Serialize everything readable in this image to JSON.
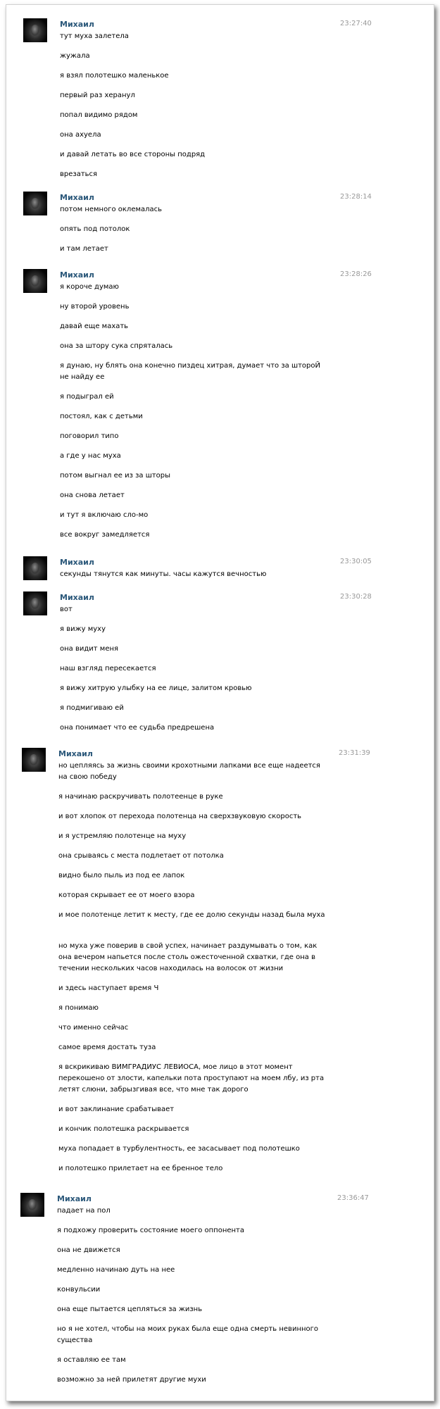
{
  "groups": [
    {
      "author": "Михаил",
      "time": "23:27:40",
      "lines": [
        "тут муха залетела",
        "жужала",
        "я взял полотешко маленькое",
        "первый раз херанул",
        "попал видимо рядом",
        "она ахуела",
        "и давай летать во все стороны подряд",
        "врезаться"
      ]
    },
    {
      "author": "Михаил",
      "time": "23:28:14",
      "lines": [
        "потом немного оклемалась",
        "опять под потолок",
        "и там летает"
      ]
    },
    {
      "author": "Михаил",
      "time": "23:28:26",
      "lines": [
        "я короче думаю",
        "ну второй уровень",
        "давай еще махать",
        "она за штору сука спряталась",
        "я дунаю, ну блять она конечно пиздец хитрая, думает что за штороЙ не найду ее",
        "я подыграл ей",
        "постоял, как с детьми",
        "поговорил типо",
        "а где у нас муха",
        "потом выгнал ее из за шторы",
        "она снова летает",
        "и тут я включаю сло-мо",
        "все вокруг замедляется"
      ]
    },
    {
      "author": "Михаил",
      "time": "23:30:05",
      "lines": [
        "секунды тянутся как минуты. часы кажутся вечностью"
      ]
    },
    {
      "author": "Михаил",
      "time": "23:30:28",
      "lines": [
        "вот",
        "я вижу муху",
        "она видит меня",
        "наш взгляд пересекается",
        "я вижу хитрую улыбку на ее лице, залитом кровью",
        "я подмигиваю ей",
        "она понимает что ее судьба предрешена"
      ]
    },
    {
      "author": "Михаил",
      "time": "23:31:39",
      "lines": [
        "но цепляясь за жизнь своими крохотными лапками все еще надеется на свою победу",
        "я начинаю раскручивать полотеенце в руке",
        "и вот хлопок от перехода полотенца на сверхзвуковую скорость",
        "и я устремляю полотенце на муху",
        "она срываясь с места подлетает от потолка",
        "видно было пыль из под ее лапок",
        "которая скрывает ее от моего взора",
        "и мое полотенце летит к месту, где ее долю секунды назад была муха",
        "но муха уже поверив в свой успех, начинает раздумывать о том, как она вечером напьется после столь ожесточенной схватки, где она в течении нескольких часов находилась на волосок от жизни",
        "и здесь наступает время Ч",
        "я понимаю",
        "что именно сейчас",
        "самое время достать туза",
        "я вскрикиваю ВИМГРАДИУС ЛЕВИОСА, мое лицо в этот момент перекошено от злости, капельки пота проступают на моем лбу, из рта летят слюни, забрызгивая все, что мне так дорого",
        "и вот заклинание срабатывает",
        "и кончик полотешка раскрывается",
        "муха попадает в турбулентность, ее засасывает под полотешко",
        "и полотешко прилетает на ее бренное тело"
      ]
    },
    {
      "author": "Михаил",
      "time": "23:36:47",
      "lines": [
        "падает на пол",
        "я подхожу проверить состояние моего оппонента",
        "она не движется",
        "медленно начинаю дуть на нее",
        "конвульсии",
        "она еще пытается цепляться за жизнь",
        "но я не хотел, чтобы на моих руках была еще одна смерть невинного существа",
        "я оставляю ее там",
        "возможно за ней прилетят другие мухи"
      ]
    }
  ]
}
